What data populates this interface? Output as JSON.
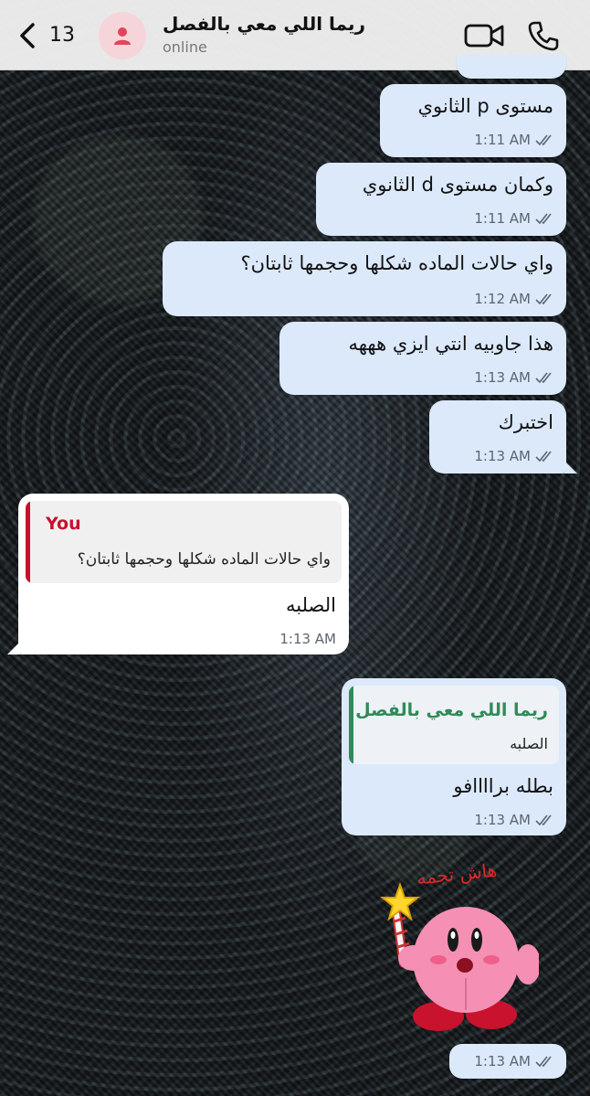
{
  "header": {
    "back_count": "13",
    "contact_name": "ريما اللي معي بالفصل",
    "status": "online"
  },
  "messages": [
    {
      "text": "",
      "time": ""
    },
    {
      "text": "مستوى p الثانوي",
      "time": "1:11 AM"
    },
    {
      "text": "وكمان مستوى d الثانوي",
      "time": "1:11 AM"
    },
    {
      "text": "واي حالات الماده شكلها وحجمها ثابتان؟",
      "time": "1:12 AM"
    },
    {
      "text": "هذا جاوبيه انتي ايزي هههه",
      "time": "1:13 AM"
    },
    {
      "text": "اختبرك",
      "time": "1:13 AM"
    }
  ],
  "reply_in": {
    "quote_author": "You",
    "quote_text": "واي حالات الماده شكلها وحجمها ثابتان؟",
    "text": "الصلبه",
    "time": "1:13 AM"
  },
  "reply_out": {
    "quote_author": "ريما اللي معي بالفصل",
    "quote_text": "الصلبه",
    "text": "بطله براااافو",
    "time": "1:13 AM"
  },
  "sticker": {
    "caption": "هاش تجمه",
    "time": "1:13 AM"
  },
  "colors": {
    "outgoing_bubble": "#dbe9fb",
    "incoming_bubble": "#ffffff",
    "you_quote": "#c8102e",
    "contact_quote": "#2e8b57"
  }
}
